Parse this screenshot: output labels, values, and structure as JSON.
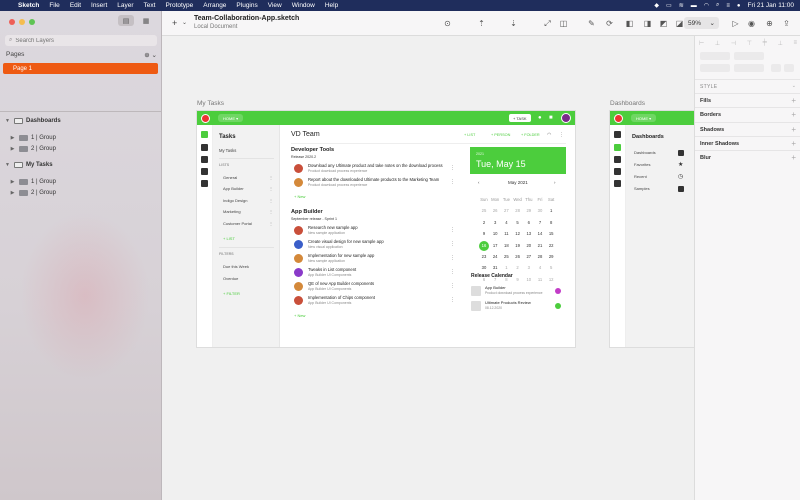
{
  "menubar": {
    "apple": "",
    "app": "Sketch",
    "items": [
      "File",
      "Edit",
      "Insert",
      "Layer",
      "Text",
      "Prototype",
      "Arrange",
      "Plugins",
      "View",
      "Window",
      "Help"
    ],
    "datetime": "Fri 21 Jan  11:00"
  },
  "sidebar": {
    "search_placeholder": "Search Layers",
    "pages_label": "Pages",
    "pages": [
      {
        "label": "Page 1"
      }
    ],
    "layers": [
      {
        "label": "Dashboards",
        "kind": "artboard"
      },
      {
        "label": "1 | Group",
        "kind": "group"
      },
      {
        "label": "2 | Group",
        "kind": "group"
      },
      {
        "label": "My Tasks",
        "kind": "artboard"
      },
      {
        "label": "1 | Group",
        "kind": "group"
      },
      {
        "label": "2 | Group",
        "kind": "group"
      }
    ]
  },
  "toolbar": {
    "insert_label": "+",
    "document_title": "Team-Collaboration-App.sketch",
    "document_subtitle": "Local Document",
    "zoom": "59%"
  },
  "canvas": {
    "artboard1": {
      "label": "My Tasks",
      "header": {
        "home": "HOME ▾",
        "task_button": "+ TASK"
      },
      "nav": {
        "title": "Tasks",
        "my_tasks": "My Tasks",
        "lists_label": "LISTS",
        "lists": [
          "General",
          "App Builder",
          "Indigo Design",
          "Marketing",
          "Customer Portal"
        ],
        "add_list": "+ LIST",
        "filters_label": "FILTERS",
        "filters": [
          "Due this Week",
          "Overdue"
        ],
        "add_filter": "+ FILTER"
      },
      "main": {
        "title": "VD Team",
        "actions": [
          "+ LIST",
          "+ PERSON",
          "+ FOLDER"
        ],
        "projects": [
          {
            "title": "Developer Tools",
            "subtitle": "Release 2020.2",
            "tasks": [
              {
                "title": "Download any Ultimate product and take notes on the download process",
                "sub": "Product download process experience",
                "color": "#c94f3a"
              },
              {
                "title": "Report about the downloaded Ultimate products to the Marketing Team",
                "sub": "Product download process experience",
                "color": "#d4893a"
              }
            ],
            "new_label": "+ New"
          },
          {
            "title": "App Builder",
            "subtitle": "September release - Sprint 1",
            "tasks": [
              {
                "title": "Research new sample app",
                "sub": "New sample application",
                "color": "#c94f3a"
              },
              {
                "title": "Create visual design for new sample app",
                "sub": "New visual application",
                "color": "#3a5ec9"
              },
              {
                "title": "Implementation for new sample app",
                "sub": "New sample application",
                "color": "#d4893a"
              },
              {
                "title": "Tweaks in List component",
                "sub": "App Builder UI Components",
                "color": "#8a3ac9"
              },
              {
                "title": "QE of new App Builder components",
                "sub": "App Builder UI Components",
                "color": "#d4893a"
              },
              {
                "title": "Implementation of Chips component",
                "sub": "App Builder UI Components",
                "color": "#c94f3a"
              }
            ],
            "new_label": "+ New"
          }
        ],
        "date_card": {
          "year": "2021",
          "day": "Tue, May 15"
        },
        "calendar": {
          "prev": "‹",
          "month": "May 2021",
          "next": "›",
          "weekdays": [
            "Sun",
            "Mon",
            "Tue",
            "Wed",
            "Thu",
            "Fri",
            "Sat"
          ],
          "rows": [
            [
              "",
              "",
              "",
              "",
              "",
              "",
              "1"
            ],
            [
              "2",
              "3",
              "4",
              "5",
              "6",
              "7",
              "8"
            ],
            [
              "9",
              "10",
              "11",
              "12",
              "13",
              "14",
              "15"
            ],
            [
              "16",
              "17",
              "18",
              "19",
              "20",
              "21",
              "22"
            ],
            [
              "23",
              "24",
              "25",
              "26",
              "27",
              "28",
              "29"
            ],
            [
              "30",
              "31",
              "",
              "",
              "",
              "",
              ""
            ]
          ],
          "rows_display": [
            [
              "25",
              "26",
              "27",
              "28",
              "29",
              "30",
              "1"
            ],
            [
              "2",
              "3",
              "4",
              "5",
              "6",
              "7",
              "8"
            ],
            [
              "9",
              "10",
              "11",
              "12",
              "13",
              "14",
              "15"
            ],
            [
              "16",
              "17",
              "18",
              "19",
              "20",
              "21",
              "22"
            ],
            [
              "23",
              "24",
              "25",
              "26",
              "27",
              "28",
              "29"
            ],
            [
              "30",
              "31",
              "1",
              "2",
              "3",
              "4",
              "5"
            ],
            [
              "6",
              "7",
              "8",
              "9",
              "10",
              "11",
              "12"
            ]
          ],
          "today": "16"
        },
        "release_calendar": {
          "title": "Release Calendar",
          "items": [
            {
              "title": "App Builder",
              "sub": "Product download process experience",
              "status_color": "#c23cc7"
            },
            {
              "title": "Ultimate Products Review",
              "sub": "08.12.2020",
              "status_color": "#4ccd3d"
            }
          ]
        }
      }
    },
    "artboard2": {
      "label": "Dashboards",
      "header": {
        "home": "HOME ▾"
      },
      "nav": {
        "title": "Dashboards",
        "items": [
          "Dashboards",
          "Favorites",
          "Recent",
          "Samples"
        ]
      }
    }
  },
  "inspector": {
    "style_label": "STYLE",
    "sections": [
      "Fills",
      "Borders",
      "Shadows",
      "Inner Shadows",
      "Blur"
    ]
  },
  "colors": {
    "accent_green": "#4ccd3d",
    "page_selected": "#ee5a12",
    "menubar": "#1f2d5c"
  }
}
